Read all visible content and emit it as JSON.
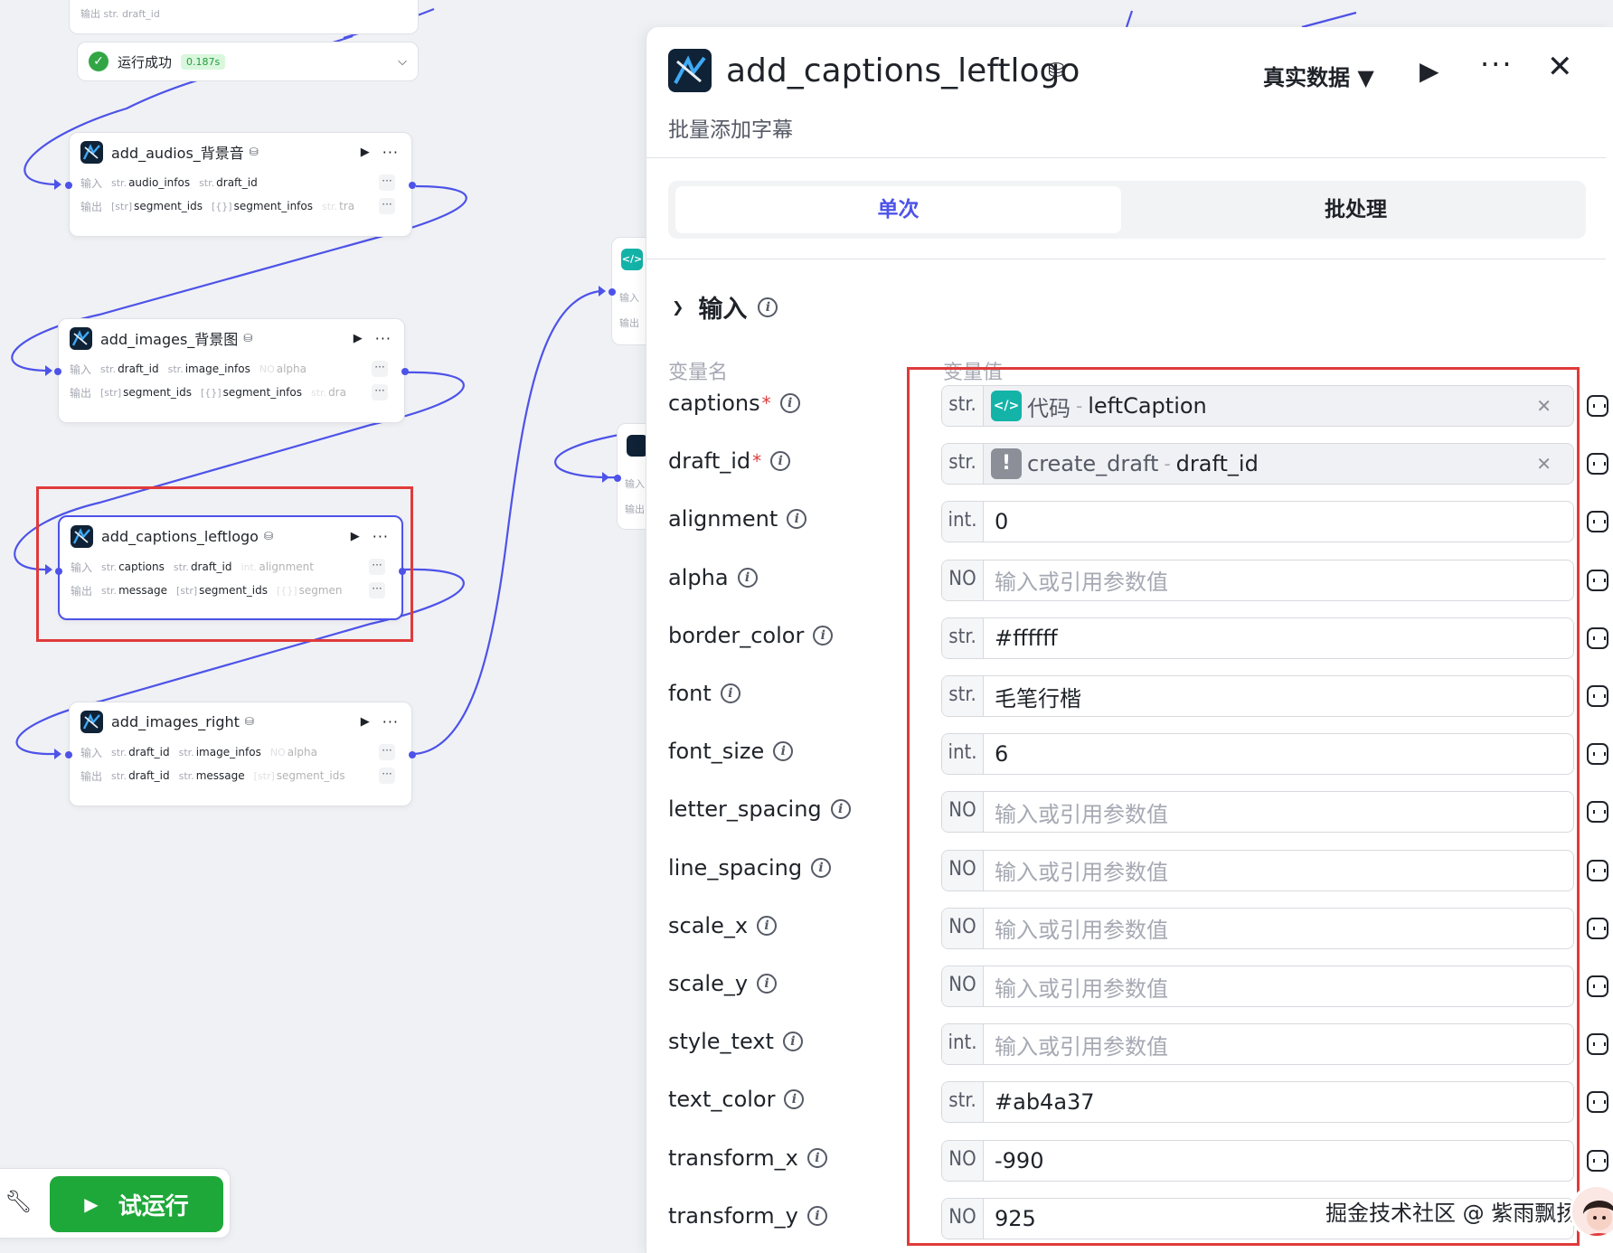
{
  "canvas": {
    "top_node": {
      "partial_label": "输出  str. draft_id"
    },
    "run_status": {
      "text": "运行成功",
      "time": "0.187s"
    },
    "nodes": [
      {
        "title": "add_audios_背景音",
        "input_label": "输入",
        "output_label": "输出",
        "inputs": [
          {
            "type": "str.",
            "name": "audio_infos"
          },
          {
            "type": "str.",
            "name": "draft_id"
          }
        ],
        "outputs": [
          {
            "type": "[str]",
            "name": "segment_ids"
          },
          {
            "type": "[{}]",
            "name": "segment_infos"
          },
          {
            "type": "str.",
            "name": "tra"
          }
        ]
      },
      {
        "title": "add_images_背景图",
        "input_label": "输入",
        "output_label": "输出",
        "inputs": [
          {
            "type": "str.",
            "name": "draft_id"
          },
          {
            "type": "str.",
            "name": "image_infos"
          },
          {
            "type": "NO",
            "name": "alpha"
          }
        ],
        "outputs": [
          {
            "type": "[str]",
            "name": "segment_ids"
          },
          {
            "type": "[{}]",
            "name": "segment_infos"
          },
          {
            "type": "str.",
            "name": "dra"
          }
        ]
      },
      {
        "title": "add_captions_leftlogo",
        "input_label": "输入",
        "output_label": "输出",
        "inputs": [
          {
            "type": "str.",
            "name": "captions"
          },
          {
            "type": "str.",
            "name": "draft_id"
          },
          {
            "type": "int.",
            "name": "alignment"
          }
        ],
        "outputs": [
          {
            "type": "str.",
            "name": "message"
          },
          {
            "type": "[str]",
            "name": "segment_ids"
          },
          {
            "type": "[{}]",
            "name": "segmen"
          }
        ]
      },
      {
        "title": "add_images_right",
        "input_label": "输入",
        "output_label": "输出",
        "inputs": [
          {
            "type": "str.",
            "name": "draft_id"
          },
          {
            "type": "str.",
            "name": "image_infos"
          },
          {
            "type": "NO",
            "name": "alpha"
          }
        ],
        "outputs": [
          {
            "type": "str.",
            "name": "draft_id"
          },
          {
            "type": "str.",
            "name": "message"
          },
          {
            "type": "[str]",
            "name": "segment_ids"
          }
        ]
      }
    ],
    "mini_nodes": [
      {
        "input_label": "输入",
        "output_label": "输出"
      },
      {
        "input_label": "输入",
        "output_label": "输出"
      }
    ],
    "trial_run_label": "试运行"
  },
  "panel": {
    "title": "add_captions_leftlogo",
    "description": "批量添加字幕",
    "data_mode": "真实数据",
    "tabs": {
      "single": "单次",
      "batch": "批处理",
      "active": "single"
    },
    "section_title": "输入",
    "col_name_header": "变量名",
    "col_value_header": "变量值",
    "params": [
      {
        "name": "captions",
        "required": true,
        "type": "str.",
        "kind": "ref",
        "ref_icon": "code-icon",
        "ref_source": "代码",
        "ref_key": "leftCaption"
      },
      {
        "name": "draft_id",
        "required": true,
        "type": "str.",
        "kind": "ref",
        "ref_icon": "warning-icon",
        "ref_source": "create_draft",
        "ref_key": "draft_id"
      },
      {
        "name": "alignment",
        "required": false,
        "type": "int.",
        "kind": "value",
        "value": "0"
      },
      {
        "name": "alpha",
        "required": false,
        "type": "NO",
        "kind": "placeholder",
        "value": "输入或引用参数值"
      },
      {
        "name": "border_color",
        "required": false,
        "type": "str.",
        "kind": "value",
        "value": "#ffffff"
      },
      {
        "name": "font",
        "required": false,
        "type": "str.",
        "kind": "value",
        "value": "毛笔行楷"
      },
      {
        "name": "font_size",
        "required": false,
        "type": "int.",
        "kind": "value",
        "value": "6"
      },
      {
        "name": "letter_spacing",
        "required": false,
        "type": "NO",
        "kind": "placeholder",
        "value": "输入或引用参数值"
      },
      {
        "name": "line_spacing",
        "required": false,
        "type": "NO",
        "kind": "placeholder",
        "value": "输入或引用参数值"
      },
      {
        "name": "scale_x",
        "required": false,
        "type": "NO",
        "kind": "placeholder",
        "value": "输入或引用参数值"
      },
      {
        "name": "scale_y",
        "required": false,
        "type": "NO",
        "kind": "placeholder",
        "value": "输入或引用参数值"
      },
      {
        "name": "style_text",
        "required": false,
        "type": "int.",
        "kind": "placeholder",
        "value": "输入或引用参数值"
      },
      {
        "name": "text_color",
        "required": false,
        "type": "str.",
        "kind": "value",
        "value": "#ab4a37"
      },
      {
        "name": "transform_x",
        "required": false,
        "type": "NO",
        "kind": "value",
        "value": "-990"
      },
      {
        "name": "transform_y",
        "required": false,
        "type": "NO",
        "kind": "value",
        "value": "925"
      }
    ]
  },
  "watermark": "掘金技术社区 @ 紫雨飘扬",
  "colors": {
    "accent": "#4d53e8",
    "success": "#32a645",
    "highlight_box": "#e03a3a",
    "code_node": "#14b3a8",
    "trial_button": "#1fa83a"
  }
}
